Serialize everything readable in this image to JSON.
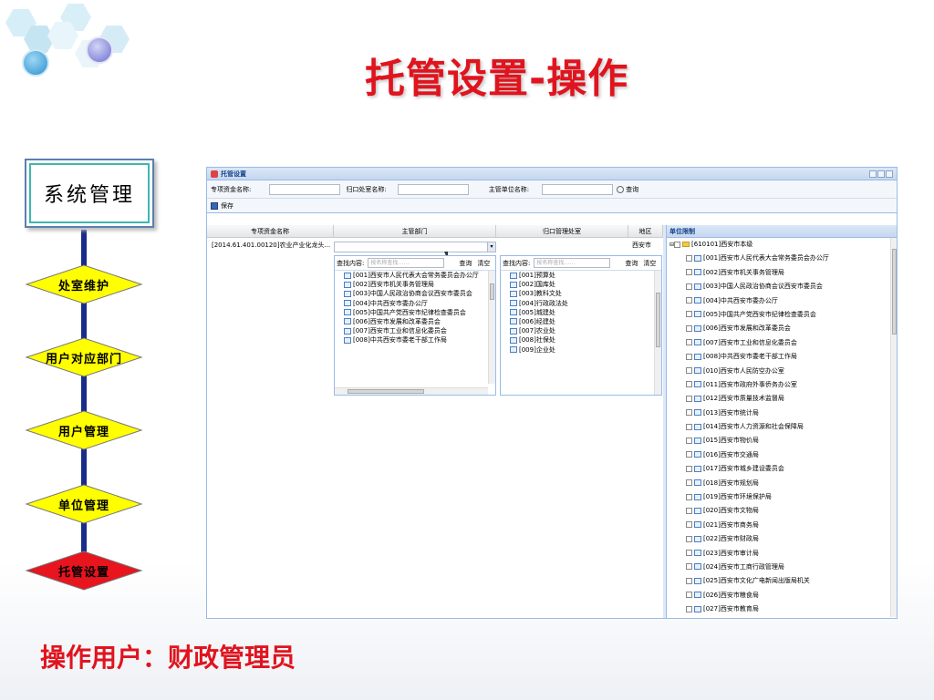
{
  "slide": {
    "title": "托管设置-操作",
    "sys_box": "系统管理",
    "nav_items": [
      "处室维护",
      "用户对应部门",
      "用户管理",
      "单位管理",
      "托管设置"
    ],
    "nav_active_index": 4,
    "footer_label": "操作用户：",
    "footer_value": "财政管理员"
  },
  "colors": {
    "title_red": "#e0141e",
    "diamond_yellow": "#ffff00",
    "diamond_active": "#e8141e",
    "line_blue": "#1a2c8a",
    "ext_blue": "#99bbe8"
  },
  "app": {
    "window_title": "托管设置",
    "filters": {
      "fund_name_label": "专项资金名称:",
      "office_label": "归口处室名称:",
      "unit_label": "主管单位名称:",
      "search_label": "查询"
    },
    "toolbar": {
      "save_label": "保存"
    },
    "grid": {
      "columns": [
        "专项资金名称",
        "主管部门",
        "归口管理处室",
        "地区"
      ],
      "row": {
        "fund": "[2014.61.401.00120]农业产业化龙头...",
        "region": "西安市"
      }
    },
    "dropdown_left": {
      "search_label": "查找内容:",
      "placeholder": "按名称查找……",
      "query_btn": "查询",
      "clear_btn": "清空",
      "items": [
        "[001]西安市人民代表大会常务委员会办公厅",
        "[002]西安市机关事务管理局",
        "[003]中国人民政治协商会议西安市委员会",
        "[004]中共西安市委办公厅",
        "[005]中国共产党西安市纪律检查委员会",
        "[006]西安市发展和改革委员会",
        "[007]西安市工业和信息化委员会",
        "[008]中共西安市委老干部工作局"
      ]
    },
    "dropdown_right": {
      "search_label": "查找内容:",
      "placeholder": "按名称查找……",
      "query_btn": "查询",
      "clear_btn": "清空",
      "items": [
        "[001]预算处",
        "[002]国库处",
        "[003]教科文处",
        "[004]行政政法处",
        "[005]城建处",
        "[006]经建处",
        "[007]农业处",
        "[008]社保处",
        "[009]企业处"
      ]
    },
    "tree": {
      "header": "单位限制",
      "root": "[610101]西安市本级",
      "items": [
        "[001]西安市人民代表大会常务委员会办公厅",
        "[002]西安市机关事务管理局",
        "[003]中国人民政治协商会议西安市委员会",
        "[004]中共西安市委办公厅",
        "[005]中国共产党西安市纪律检查委员会",
        "[006]西安市发展和改革委员会",
        "[007]西安市工业和信息化委员会",
        "[008]中共西安市委老干部工作局",
        "[010]西安市人民防空办公室",
        "[011]西安市政府外事侨务办公室",
        "[012]西安市质量技术监督局",
        "[013]西安市统计局",
        "[014]西安市人力资源和社会保障局",
        "[015]西安市物价局",
        "[016]西安市交通局",
        "[017]西安市城乡建设委员会",
        "[018]西安市规划局",
        "[019]西安市环境保护局",
        "[020]西安市文物局",
        "[021]西安市商务局",
        "[022]西安市财政局",
        "[023]西安市审计局",
        "[024]西安市工商行政管理局",
        "[025]西安市文化广电新闻出版局机关",
        "[026]西安市粮食局",
        "[027]西安市教育局"
      ]
    }
  }
}
